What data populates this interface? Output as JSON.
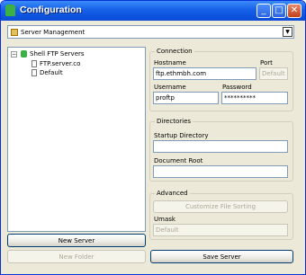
{
  "window": {
    "title": "Configuration"
  },
  "title_buttons": {
    "minimize": "_",
    "maximize": "□",
    "close": "✕"
  },
  "combo": {
    "value": "Server Management",
    "arrow": "▼"
  },
  "tree": {
    "root": {
      "expander": "−",
      "label": "Shell FTP Servers"
    },
    "items": [
      "FTP.server.co",
      "Default"
    ]
  },
  "buttons": {
    "new_server": "New Server",
    "new_folder": "New Folder",
    "save_server": "Save Server",
    "customize_file_sorting": "Customize File Sorting"
  },
  "connection": {
    "legend": "Connection",
    "hostname_label": "Hostname",
    "hostname_value": "ftp.ethmbh.com",
    "port_label": "Port",
    "port_placeholder": "Default",
    "username_label": "Username",
    "username_value": "proftp",
    "password_label": "Password",
    "password_value": "**********"
  },
  "directories": {
    "legend": "Directories",
    "startup_label": "Startup Directory",
    "startup_value": "",
    "document_root_label": "Document Root",
    "document_root_value": ""
  },
  "advanced": {
    "legend": "Advanced",
    "umask_label": "Umask",
    "umask_placeholder": "Default"
  }
}
